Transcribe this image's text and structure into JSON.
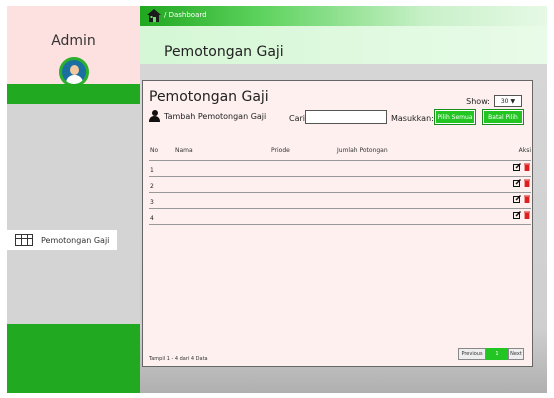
{
  "sidebar": {
    "title": "Admin",
    "menu_item_label": "Pemotongan Gaji"
  },
  "topbar": {
    "breadcrumb": "/ Dashboard"
  },
  "header": {
    "title": "Pemotongan Gaji"
  },
  "card": {
    "title": "Pemotongan Gaji",
    "show_label": "Show:",
    "show_value": "30",
    "add_label": "Tambah Pemotongan Gaji",
    "search_label": "Cari:",
    "search_value": "",
    "masukkan_label": "Masukkan:",
    "select_all_label": "Pilih Semua",
    "cancel_select_label": "Batal Pilih",
    "columns": [
      "No",
      "Nama",
      "Priode",
      "Jumlah Potongan",
      "Aksi"
    ],
    "rows": [
      {
        "no": "1"
      },
      {
        "no": "2"
      },
      {
        "no": "3"
      },
      {
        "no": "4"
      }
    ],
    "footer_info": "Tampil 1 - 4 dari 4 Data",
    "pagination": {
      "prev": "Previous",
      "current": "1",
      "next": "Next"
    }
  },
  "colors": {
    "accent_green": "#22a922",
    "button_green": "#22c522",
    "delete_red": "#e02020",
    "card_bg": "#fdf0ef"
  }
}
